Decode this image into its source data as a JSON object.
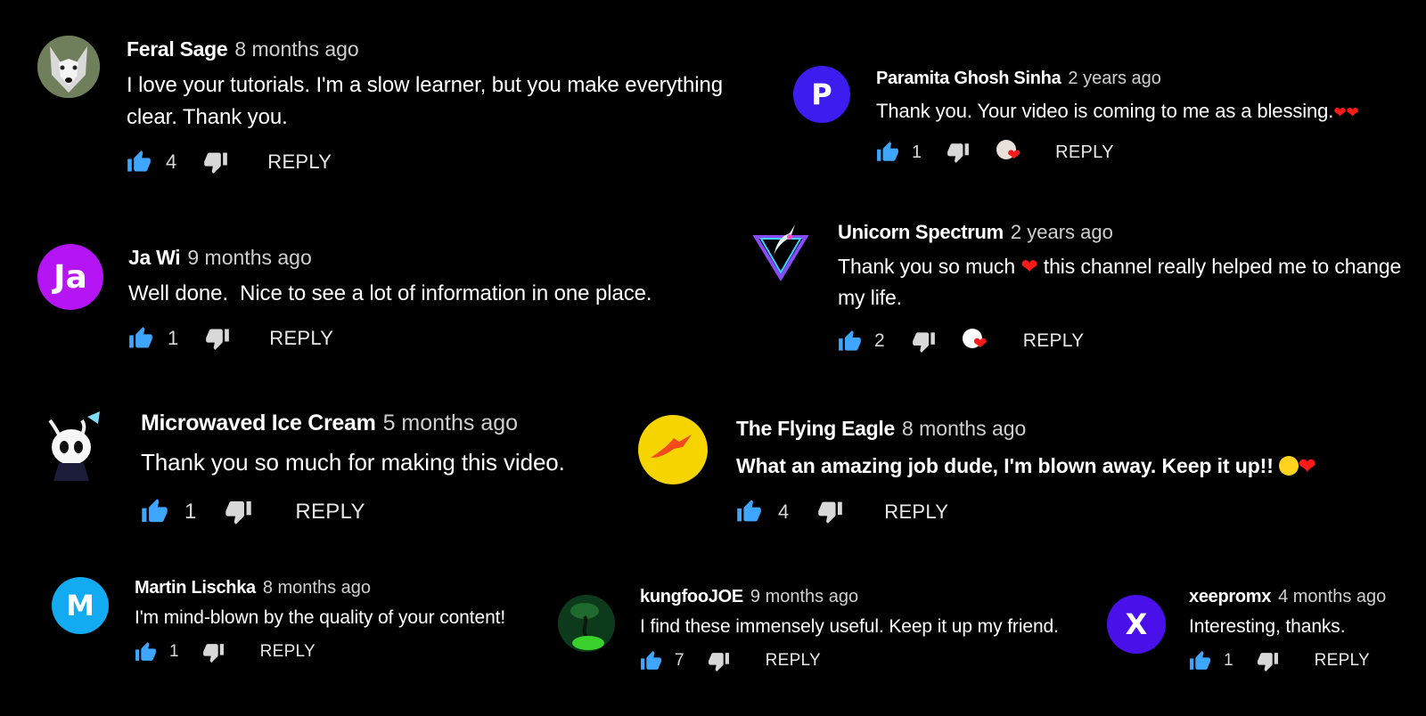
{
  "icons": {
    "like": "thumbs-up-icon",
    "dislike": "thumbs-down-icon",
    "heart": "heart-icon"
  },
  "colors": {
    "background": "#000000",
    "like_blue": "#3ea6ff",
    "heart_red": "#ff1a1a"
  },
  "comments": [
    {
      "author": "Feral Sage",
      "time": "8 months ago",
      "text": "I love your tutorials. I'm a slow learner, but you make everything clear. Thank you.",
      "likes": "4",
      "reply_label": "REPLY",
      "avatar_type": "wolf-photo"
    },
    {
      "author": "Paramita Ghosh Sinha",
      "time": "2 years ago",
      "text": "Thank you. Your video is coming to me as a blessing.",
      "likes": "1",
      "reply_label": "REPLY",
      "avatar_letter": "P",
      "avatar_color": "#3d1cf0",
      "creator_hearted": true
    },
    {
      "author": "Ja Wi",
      "time": "9 months ago",
      "text": "Well done.  Nice to see a lot of information in one place.",
      "likes": "1",
      "reply_label": "REPLY",
      "avatar_letter": "Ja",
      "avatar_color": "#b515f5"
    },
    {
      "author": "Unicorn Spectrum",
      "time": "2 years ago",
      "text": "Thank you so much",
      "text_after": "this channel really helped me to change my life.",
      "likes": "2",
      "reply_label": "REPLY",
      "avatar_type": "unicorn-logo",
      "creator_hearted": true
    },
    {
      "author": "Microwaved Ice Cream",
      "time": "5 months ago",
      "text": "Thank you so much for making this video.",
      "likes": "1",
      "reply_label": "REPLY",
      "avatar_type": "knight-character"
    },
    {
      "author": "The Flying Eagle",
      "time": "8 months ago",
      "text": "What an amazing job dude, I'm blown away. Keep it up!!",
      "likes": "4",
      "reply_label": "REPLY",
      "avatar_type": "eagle-logo",
      "avatar_color": "#f5d400"
    },
    {
      "author": "Martin Lischka",
      "time": "8 months ago",
      "text": "I'm mind-blown by the quality of your content!",
      "likes": "1",
      "reply_label": "REPLY",
      "avatar_letter": "M",
      "avatar_color": "#12aaf0"
    },
    {
      "author": "kungfooJOE",
      "time": "9 months ago",
      "text": "I find these immensely useful. Keep it up my friend.",
      "likes": "7",
      "reply_label": "REPLY",
      "avatar_type": "tree-photo"
    },
    {
      "author": "xeepromx",
      "time": "4 months ago",
      "text": "Interesting, thanks.",
      "likes": "1",
      "reply_label": "REPLY",
      "avatar_letter": "X",
      "avatar_color": "#4a10ea"
    }
  ]
}
